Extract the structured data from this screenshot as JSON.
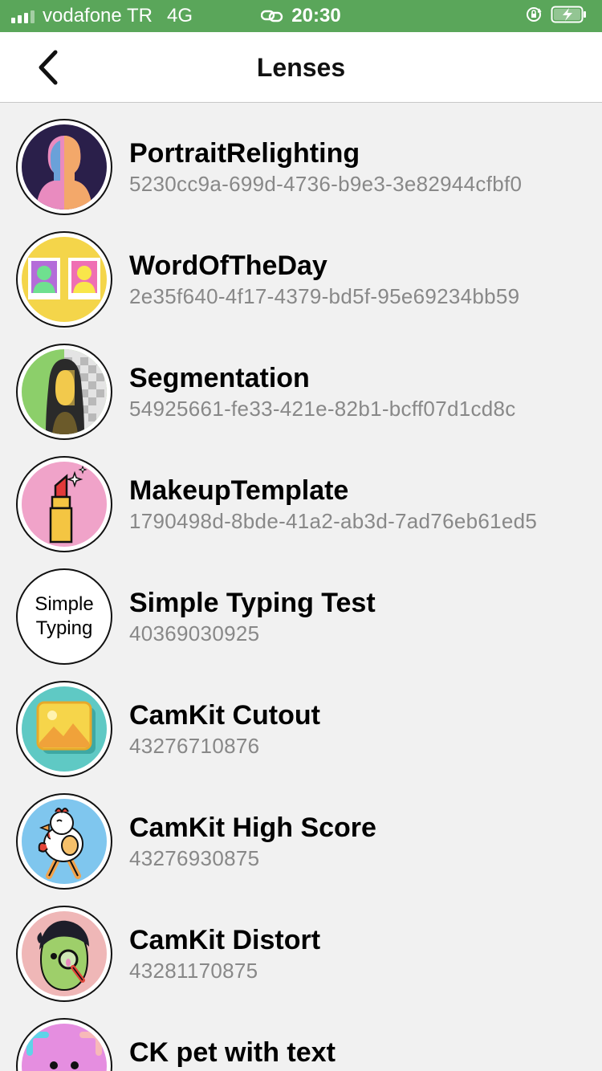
{
  "status_bar": {
    "carrier": "vodafone TR",
    "network": "4G",
    "time": "20:30",
    "icons": [
      "signal-icon",
      "link-icon",
      "rotation-lock-icon",
      "battery-charging-icon"
    ]
  },
  "nav": {
    "back_icon": "chevron-left-icon",
    "title": "Lenses"
  },
  "lenses": [
    {
      "name": "PortraitRelighting",
      "id": "5230cc9a-699d-4736-b9e3-3e82944cfbf0",
      "icon": "portrait-relighting-icon"
    },
    {
      "name": "WordOfTheDay",
      "id": "2e35f640-4f17-4379-bd5f-95e69234bb59",
      "icon": "word-of-the-day-icon"
    },
    {
      "name": "Segmentation",
      "id": "54925661-fe33-421e-82b1-bcff07d1cd8c",
      "icon": "segmentation-icon"
    },
    {
      "name": "MakeupTemplate",
      "id": "1790498d-8bde-41a2-ab3d-7ad76eb61ed5",
      "icon": "lipstick-icon"
    },
    {
      "name": "Simple Typing Test",
      "id": "40369030925",
      "icon": "simple-typing-icon",
      "icon_text": [
        "Simple",
        "Typing"
      ]
    },
    {
      "name": "CamKit Cutout",
      "id": "43276710876",
      "icon": "image-cutout-icon"
    },
    {
      "name": "CamKit High Score",
      "id": "43276930875",
      "icon": "chicken-icon"
    },
    {
      "name": "CamKit Distort",
      "id": "43281170875",
      "icon": "distort-face-icon"
    },
    {
      "name": "CK pet with text",
      "id": "",
      "icon": "pet-icon"
    }
  ],
  "colors": {
    "status_bar_bg": "#5aa65a",
    "nav_bg": "#ffffff",
    "list_bg": "#f1f1f1",
    "id_text": "#888888"
  }
}
